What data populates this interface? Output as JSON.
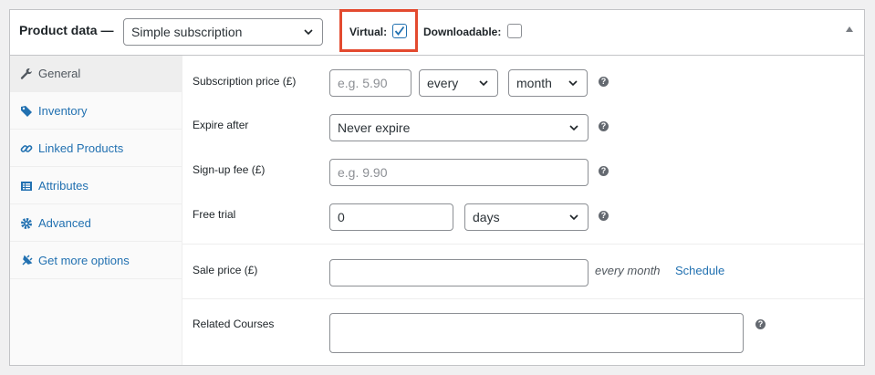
{
  "header": {
    "title": "Product data —",
    "product_type": "Simple subscription",
    "virtual_label": "Virtual:",
    "virtual_checked": true,
    "downloadable_label": "Downloadable:",
    "downloadable_checked": false,
    "highlight_color": "#e34a2f"
  },
  "tabs": [
    {
      "label": "General",
      "icon": "wrench-icon",
      "active": true
    },
    {
      "label": "Inventory",
      "icon": "tag-icon"
    },
    {
      "label": "Linked Products",
      "icon": "link-icon"
    },
    {
      "label": "Attributes",
      "icon": "list-icon"
    },
    {
      "label": "Advanced",
      "icon": "gear-icon"
    },
    {
      "label": "Get more options",
      "icon": "plugin-icon"
    }
  ],
  "fields": {
    "subscription_price": {
      "label": "Subscription price (£)",
      "placeholder": "e.g. 5.90",
      "interval": "every",
      "period": "month"
    },
    "expire_after": {
      "label": "Expire after",
      "value": "Never expire"
    },
    "signup_fee": {
      "label": "Sign-up fee (£)",
      "placeholder": "e.g. 9.90"
    },
    "free_trial": {
      "label": "Free trial",
      "value": "0",
      "period": "days"
    },
    "sale_price": {
      "label": "Sale price (£)",
      "suffix": "every month",
      "schedule_link": "Schedule"
    },
    "related_courses": {
      "label": "Related Courses"
    }
  },
  "help_glyph": "?",
  "colors": {
    "accent": "#2271b1",
    "active_tab_bg": "#eeeeee"
  }
}
